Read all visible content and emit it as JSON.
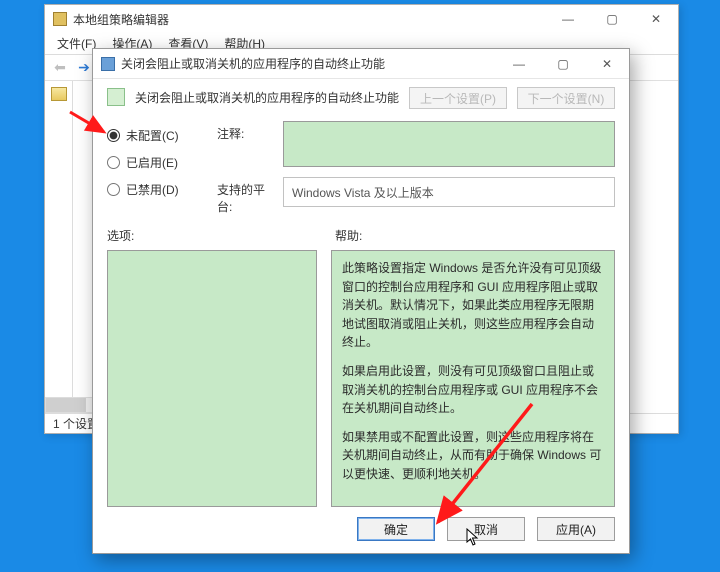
{
  "gp": {
    "title": "本地组策略编辑器",
    "menu": {
      "file": "文件(F)",
      "action": "操作(A)",
      "view": "查看(V)",
      "help": "帮助(H)"
    },
    "status": "1 个设置"
  },
  "dlg": {
    "title": "关闭会阻止或取消关机的应用程序的自动终止功能",
    "heading": "关闭会阻止或取消关机的应用程序的自动终止功能",
    "nav": {
      "prev": "上一个设置(P)",
      "next": "下一个设置(N)"
    },
    "radios": {
      "not_configured": "未配置(C)",
      "enabled": "已启用(E)",
      "disabled": "已禁用(D)",
      "selected": "not_configured"
    },
    "comment_label": "注释:",
    "comment_value": "",
    "platform_label": "支持的平台:",
    "platform_value": "Windows Vista 及以上版本",
    "options_label": "选项:",
    "help_label": "帮助:",
    "help_text": {
      "p1": "此策略设置指定 Windows 是否允许没有可见顶级窗口的控制台应用程序和 GUI 应用程序阻止或取消关机。默认情况下，如果此类应用程序无限期地试图取消或阻止关机，则这些应用程序会自动终止。",
      "p2": "如果启用此设置，则没有可见顶级窗口且阻止或取消关机的控制台应用程序或 GUI 应用程序不会在关机期间自动终止。",
      "p3": "如果禁用或不配置此设置，则这些应用程序将在关机期间自动终止，从而有助于确保 Windows 可以更快速、更顺利地关机。"
    },
    "buttons": {
      "ok": "确定",
      "cancel": "取消",
      "apply": "应用(A)"
    }
  }
}
